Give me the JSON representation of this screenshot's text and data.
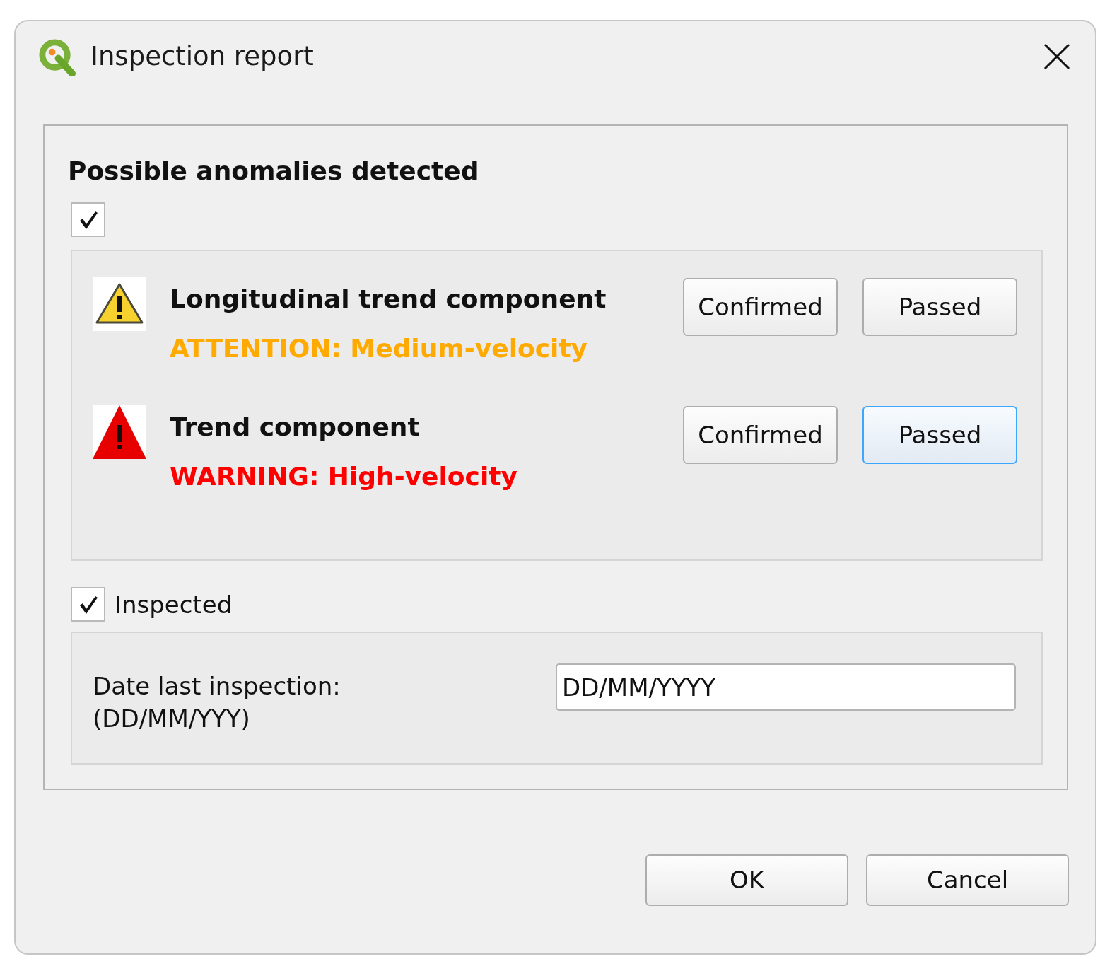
{
  "window": {
    "title": "Inspection report"
  },
  "anomalies": {
    "heading": "Possible anomalies detected",
    "checked": true,
    "items": [
      {
        "kind": "attention",
        "title": "Longitudinal trend component",
        "message": "ATTENTION: Medium-velocity",
        "color": "#ffaa00",
        "buttons": [
          {
            "label": "Confirmed",
            "focused": false
          },
          {
            "label": "Passed",
            "focused": false
          }
        ]
      },
      {
        "kind": "warning",
        "title": "Trend component",
        "message": "WARNING: High-velocity",
        "color": "#ff0000",
        "buttons": [
          {
            "label": "Confirmed",
            "focused": false
          },
          {
            "label": "Passed",
            "focused": true
          }
        ]
      }
    ]
  },
  "inspection": {
    "label": "Inspected",
    "checked": true,
    "date_label": "Date last inspection:\n(DD/MM/YYY)",
    "date_value": "DD/MM/YYYY"
  },
  "buttons": [
    {
      "label": "OK"
    },
    {
      "label": "Cancel"
    }
  ]
}
